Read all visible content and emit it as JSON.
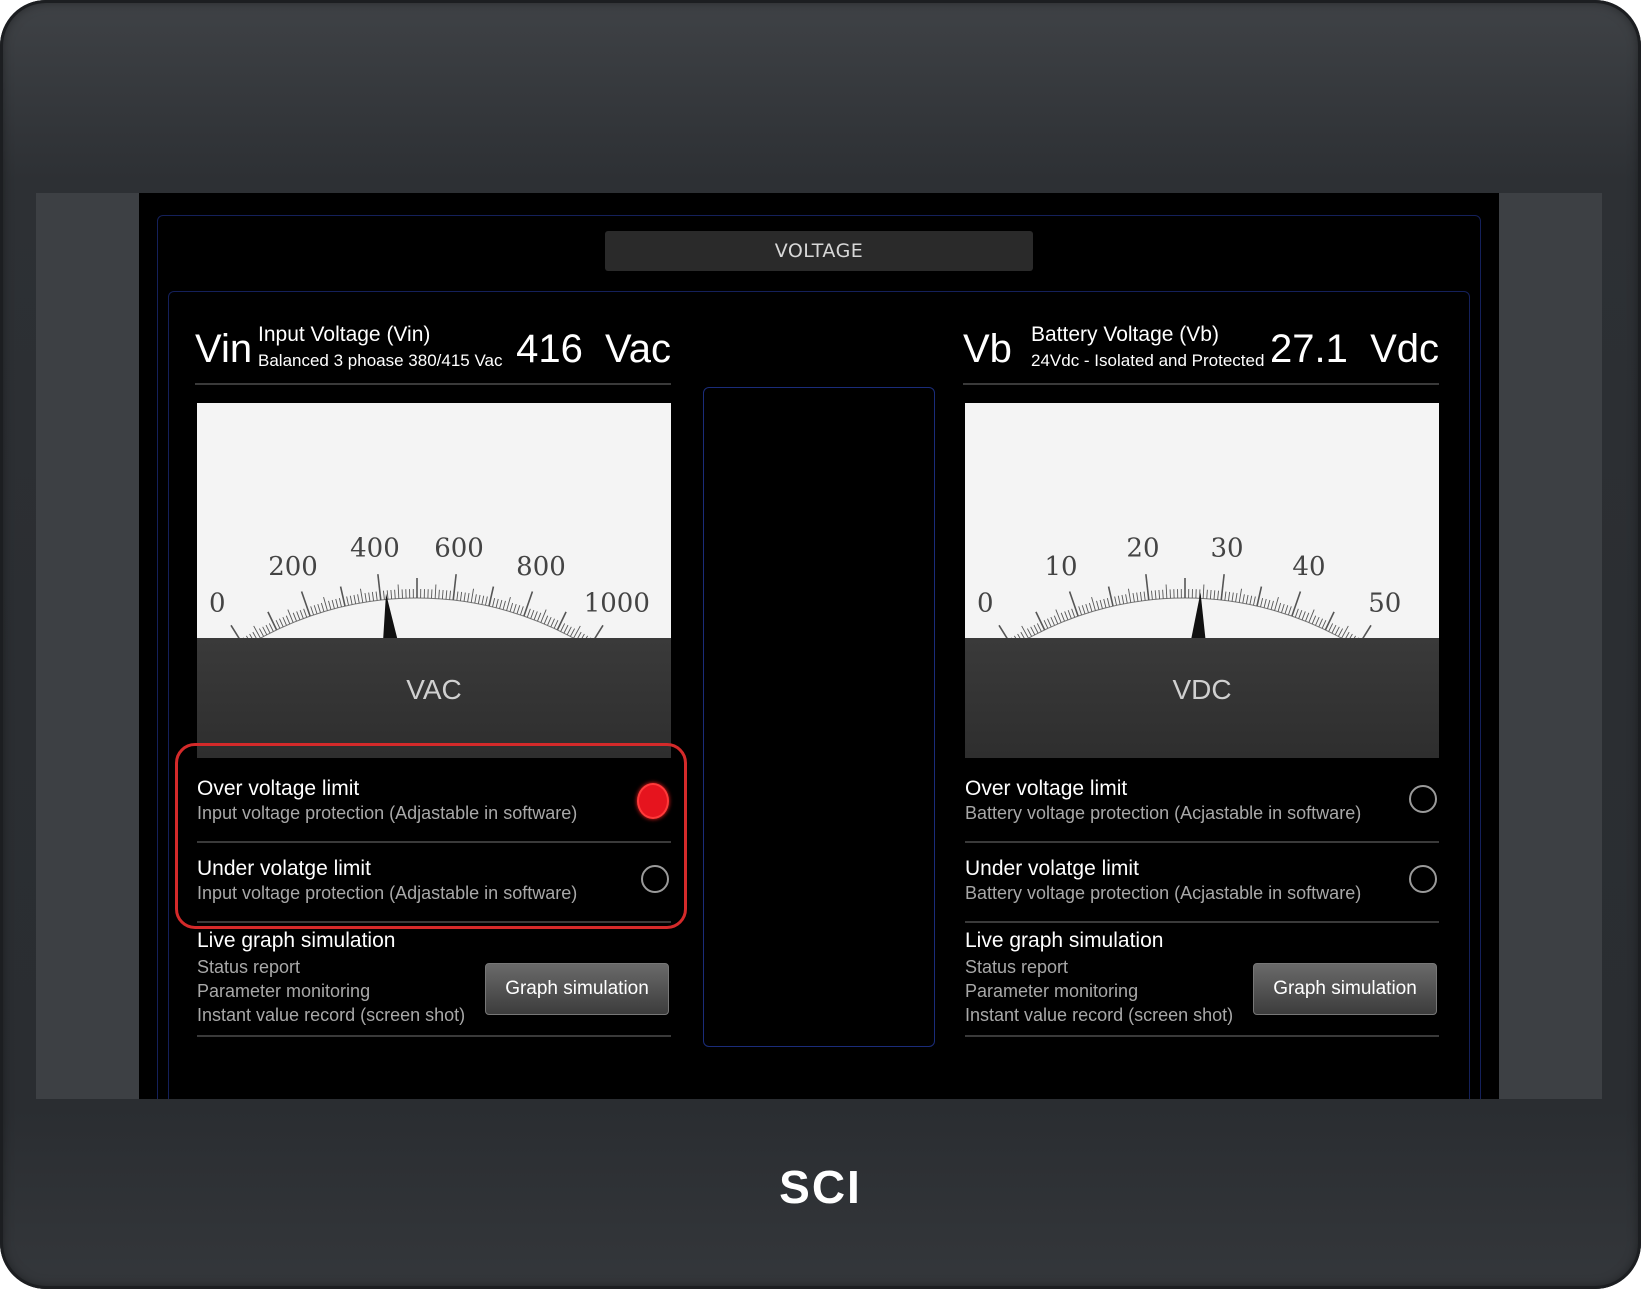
{
  "screen": {
    "title": "VOLTAGE"
  },
  "left": {
    "symbol": "Vin",
    "title": "Input Voltage (Vin)",
    "subtitle": "Balanced 3 phoase 380/415 Vac",
    "reading": "416  Vac",
    "meter": {
      "scale_labels": [
        "0",
        "200",
        "400",
        "600",
        "800",
        "1000"
      ],
      "unit": "VAC",
      "value": 416,
      "min": 0,
      "max": 1000
    },
    "over": {
      "title": "Over voltage limit",
      "desc": "Input voltage protection (Adjastable in software)",
      "state": "active"
    },
    "under": {
      "title": "Under volatge limit",
      "desc": "Input voltage protection (Adjastable in software)",
      "state": "inactive"
    },
    "live": {
      "title": "Live graph simulation",
      "items": [
        "Status report",
        "Parameter monitoring",
        "Instant value record (screen shot)"
      ],
      "button": "Graph simulation"
    }
  },
  "right": {
    "symbol": "Vb",
    "title": "Battery Voltage (Vb)",
    "subtitle": "24Vdc - Isolated and Protected",
    "reading": "27.1  Vdc",
    "meter": {
      "scale_labels": [
        "0",
        "10",
        "20",
        "30",
        "40",
        "50"
      ],
      "unit": "VDC",
      "value": 27.1,
      "min": 0,
      "max": 50
    },
    "over": {
      "title": "Over voltage limit",
      "desc": "Battery voltage protection (Acjastable in software)",
      "state": "inactive"
    },
    "under": {
      "title": "Under volatge limit",
      "desc": "Battery voltage protection (Acjastable in software)",
      "state": "inactive"
    },
    "live": {
      "title": "Live graph simulation",
      "items": [
        "Status report",
        "Parameter monitoring",
        "Instant value record (screen shot)"
      ],
      "button": "Graph simulation"
    }
  },
  "colors": {
    "alarm": "#e6141e",
    "highlight": "#d42a2a",
    "frame": "#14205a"
  },
  "brand": "SCI"
}
